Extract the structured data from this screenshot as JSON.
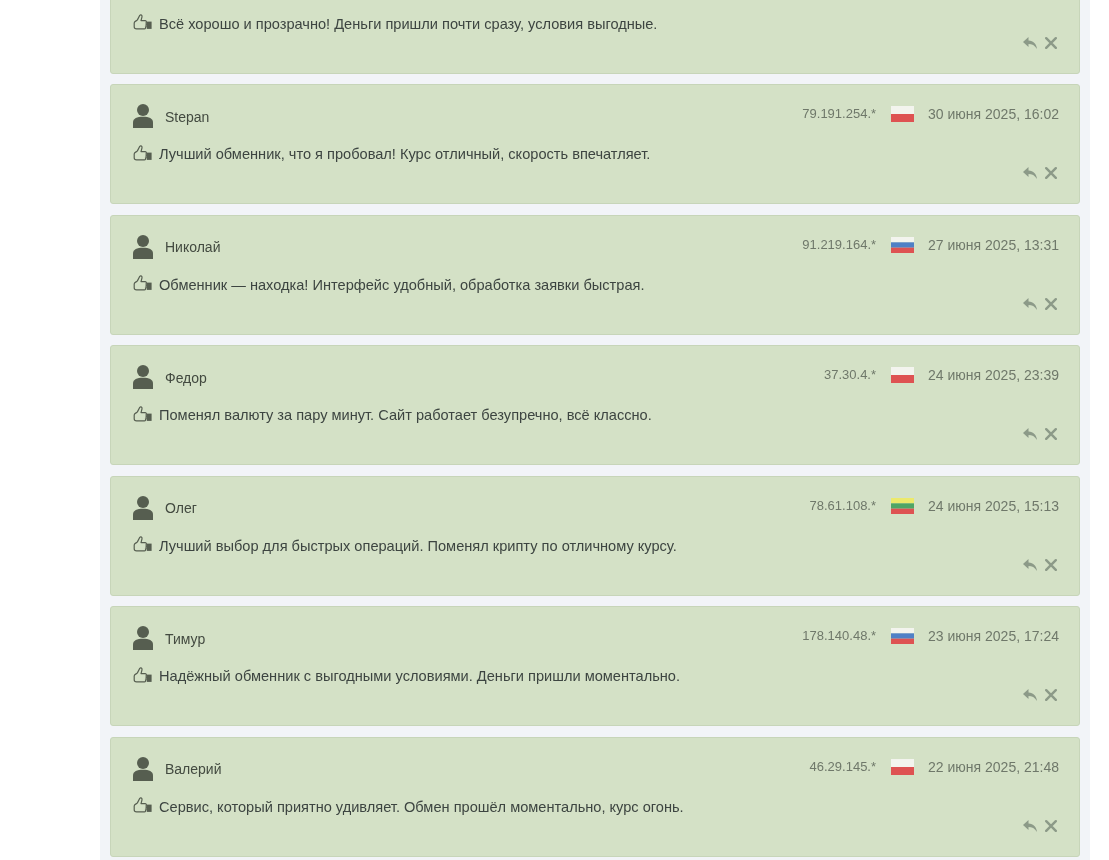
{
  "reviews": [
    {
      "text": "Всё хорошо и прозрачно! Деньги пришли почти сразу, условия выгодные."
    },
    {
      "name": "Stepan",
      "ip": "79.191.254.*",
      "flag_stripes": [
        {
          "color": "#f3f4ee"
        },
        {
          "color": "#de5252"
        }
      ],
      "date": "30 июня 2025, 16:02",
      "text": "Лучший обменник, что я пробовал! Курс отличный, скорость впечатляет."
    },
    {
      "name": "Николай",
      "ip": "91.219.164.*",
      "flag_stripes": [
        {
          "color": "#f3f4ee"
        },
        {
          "color": "#4f80c6"
        },
        {
          "color": "#de5252"
        }
      ],
      "date": "27 июня 2025, 13:31",
      "text": "Обменник — находка! Интерфейс удобный, обработка заявки быстрая."
    },
    {
      "name": "Федор",
      "ip": "37.30.4.*",
      "flag_stripes": [
        {
          "color": "#f3f4ee"
        },
        {
          "color": "#de5252"
        }
      ],
      "date": "24 июня 2025, 23:39",
      "text": "Поменял валюту за пару минут. Сайт работает безупречно, всё классно."
    },
    {
      "name": "Олег",
      "ip": "78.61.108.*",
      "flag_stripes": [
        {
          "color": "#ece96c"
        },
        {
          "color": "#4fa565"
        },
        {
          "color": "#de5252"
        }
      ],
      "date": "24 июня 2025, 15:13",
      "text": "Лучший выбор для быстрых операций. Поменял крипту по отличному курсу."
    },
    {
      "name": "Тимур",
      "ip": "178.140.48.*",
      "flag_stripes": [
        {
          "color": "#f3f4ee"
        },
        {
          "color": "#4f80c6"
        },
        {
          "color": "#de5252"
        }
      ],
      "date": "23 июня 2025, 17:24",
      "text": "Надёжный обменник с выгодными условиями. Деньги пришли моментально."
    },
    {
      "name": "Валерий",
      "ip": "46.29.145.*",
      "flag_stripes": [
        {
          "color": "#f3f4ee"
        },
        {
          "color": "#de5252"
        }
      ],
      "date": "22 июня 2025, 21:48",
      "text": "Сервис, который приятно удивляет. Обмен прошёл моментально, курс огонь."
    }
  ]
}
